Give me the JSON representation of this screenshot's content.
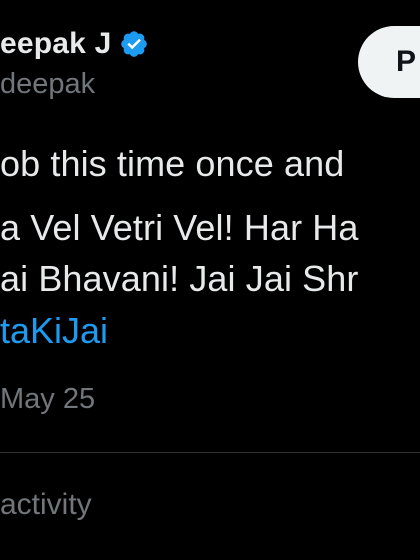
{
  "tweet": {
    "author_name": "eepak J",
    "handle": "deepak",
    "action_button_label": "P",
    "lines": [
      "ob this time once and",
      "a Vel Vetri Vel! Har Ha",
      "ai Bhavani! Jai Jai Shr"
    ],
    "hashtag": "taKiJai",
    "timestamp": "May 25",
    "activity_label": "activity"
  },
  "colors": {
    "background": "#000000",
    "primary_text": "#e7e9ea",
    "secondary_text": "#71767b",
    "link": "#1d9bf0",
    "verified_badge": "#1d9bf0",
    "button_bg": "#eff3f4",
    "divider": "#2f3336"
  },
  "icons": {
    "verified": "verified-badge-icon"
  }
}
